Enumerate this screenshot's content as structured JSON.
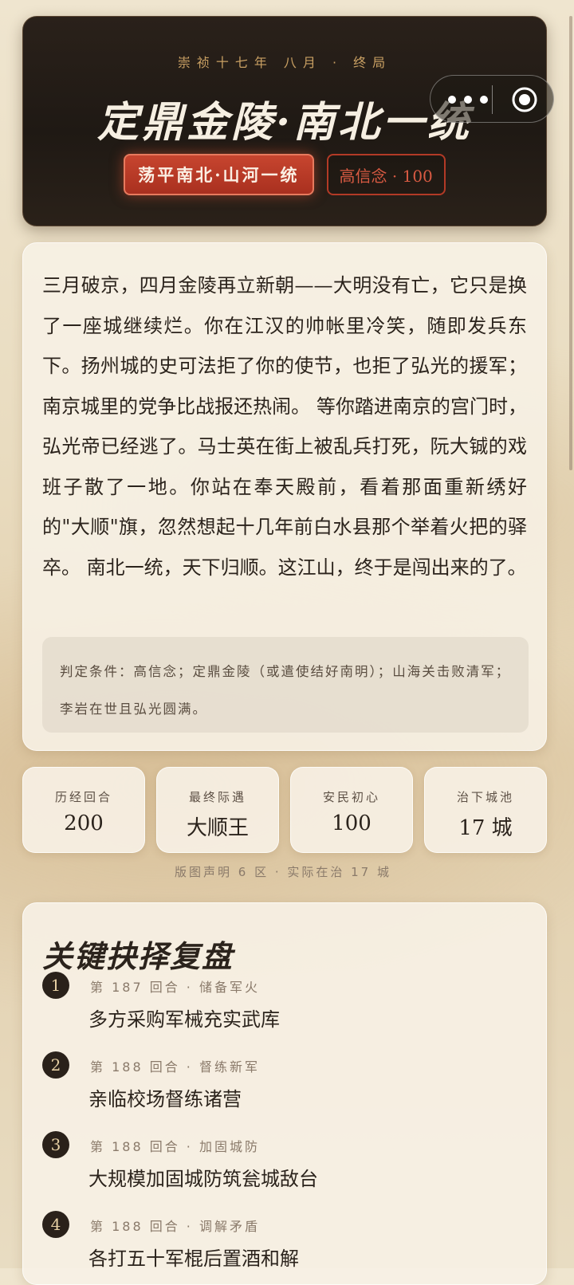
{
  "header": {
    "kicker": "崇祯十七年 八月 · 终局",
    "title": "定鼎金陵·南北一统",
    "badge_primary": "荡平南北·山河一统",
    "badge_secondary": "高信念 · 100"
  },
  "capsule": {
    "more_icon": "more-dots-icon",
    "close_icon": "target-close-icon"
  },
  "narrative": {
    "text": "三月破京，四月金陵再立新朝——大明没有亡，它只是换了一座城继续烂。你在江汉的帅帐里冷笑，随即发兵东下。扬州城的史可法拒了你的使节，也拒了弘光的援军；南京城里的党争比战报还热闹。 等你踏进南京的宫门时，弘光帝已经逃了。马士英在街上被乱兵打死，阮大铖的戏班子散了一地。你站在奉天殿前，看着那面重新绣好的\"大顺\"旗，忽然想起十几年前白水县那个举着火把的驿卒。 南北一统，天下归顺。这江山，终于是闯出来的了。",
    "condition": "判定条件：高信念；定鼎金陵（或遣使结好南明）；山海关击败清军；李岩在世且弘光圆满。"
  },
  "stats": [
    {
      "label": "历经回合",
      "value": "200"
    },
    {
      "label": "最终际遇",
      "value": "大顺王"
    },
    {
      "label": "安民初心",
      "value": "100"
    },
    {
      "label": "治下城池",
      "value": "17 城"
    }
  ],
  "territory_note": "版图声明 6 区 · 实际在治 17 城",
  "choices": {
    "title": "关键抉择复盘",
    "items": [
      {
        "num": "1",
        "meta": "第 187 回合 · 储备军火",
        "text": "多方采购军械充实武库"
      },
      {
        "num": "2",
        "meta": "第 188 回合 · 督练新军",
        "text": "亲临校场督练诸营"
      },
      {
        "num": "3",
        "meta": "第 188 回合 · 加固城防",
        "text": "大规模加固城防筑瓮城敌台"
      },
      {
        "num": "4",
        "meta": "第 188 回合 · 调解矛盾",
        "text": "各打五十军棍后置酒和解"
      }
    ]
  }
}
